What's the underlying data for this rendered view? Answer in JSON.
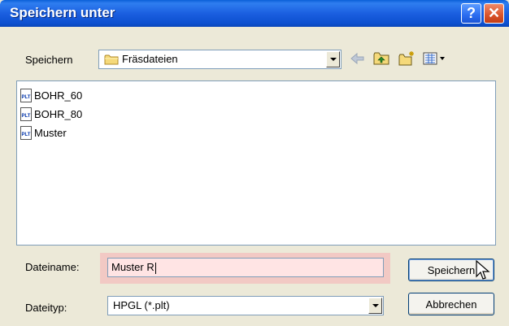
{
  "window": {
    "title": "Speichern unter",
    "help_glyph": "?",
    "close_glyph": "✕"
  },
  "toolbar": {
    "save_in_label": "Speichern",
    "folder": "Fräsdateien",
    "icons": [
      "back-arrow-icon",
      "up-folder-icon",
      "new-folder-icon",
      "view-menu-icon"
    ]
  },
  "files": [
    {
      "name": "BOHR_60",
      "icon": "plt-file-icon",
      "badge": "PLT"
    },
    {
      "name": "BOHR_80",
      "icon": "plt-file-icon",
      "badge": "PLT"
    },
    {
      "name": "Muster",
      "icon": "plt-file-icon",
      "badge": "PLT"
    }
  ],
  "filename": {
    "label": "Dateiname:",
    "value": "Muster R"
  },
  "filetype": {
    "label": "Dateityp:",
    "value": "HPGL (*.plt)"
  },
  "buttons": {
    "save": "Speichern",
    "cancel": "Abbrechen"
  },
  "colors": {
    "title_blue": "#1b5fe0",
    "close_red": "#d9532a",
    "highlight": "#f2c9c4"
  }
}
